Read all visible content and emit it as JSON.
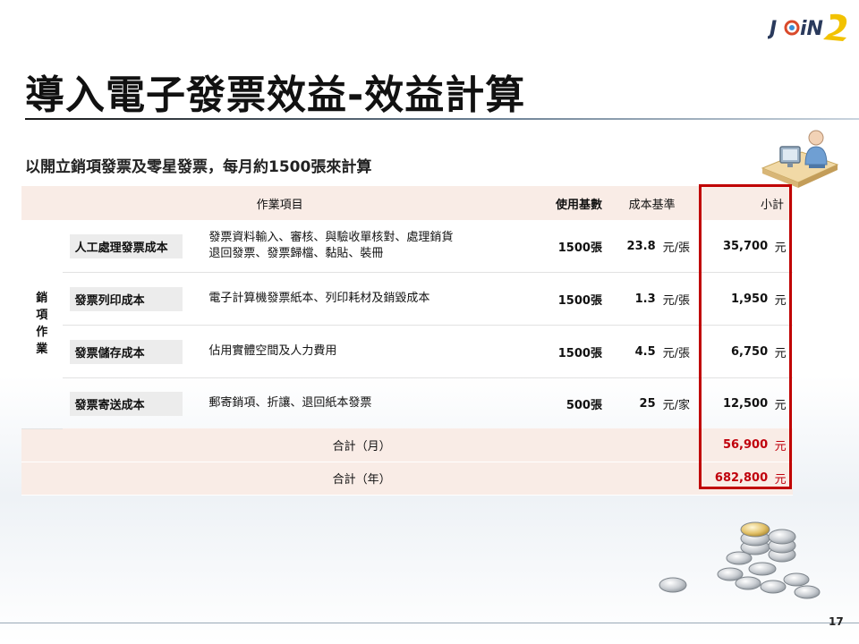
{
  "brand": {
    "logo_text": "JOIN"
  },
  "slide": {
    "title": "導入電子發票效益-效益計算",
    "subtitle": "以開立銷項發票及零星發票，每月約1500張來計算",
    "page_number": "17"
  },
  "table": {
    "headers": {
      "item": "作業項目",
      "count": "使用基數",
      "base": "成本基準",
      "subtotal": "小計"
    },
    "side_label": "銷項作業",
    "rows": [
      {
        "name": "人工處理發票成本",
        "desc_line1": "發票資料輸入、審核、與驗收單核對、處理銷貨",
        "desc_line2": "退回發票、發票歸檔、黏貼、裝冊",
        "count": "1500張",
        "base": "23.8",
        "unit": "元/張",
        "subtotal": "35,700",
        "currency": "元"
      },
      {
        "name": "發票列印成本",
        "desc_line1": "電子計算機發票紙本、列印耗材及銷毀成本",
        "desc_line2": "",
        "count": "1500張",
        "base": "1.3",
        "unit": "元/張",
        "subtotal": "1,950",
        "currency": "元"
      },
      {
        "name": "發票儲存成本",
        "desc_line1": "佔用實體空間及人力費用",
        "desc_line2": "",
        "count": "1500張",
        "base": "4.5",
        "unit": "元/張",
        "subtotal": "6,750",
        "currency": "元"
      },
      {
        "name": "發票寄送成本",
        "desc_line1": "郵寄銷項、折讓、退回紙本發票",
        "desc_line2": "",
        "count": "500張",
        "base": "25",
        "unit": "元/家",
        "subtotal": "12,500",
        "currency": "元"
      }
    ],
    "totals": [
      {
        "label": "合計（月）",
        "value": "56,900",
        "currency": "元"
      },
      {
        "label": "合計（年）",
        "value": "682,800",
        "currency": "元"
      }
    ]
  },
  "colors": {
    "highlight_frame": "#c00000",
    "total_text": "#c0000c",
    "header_bg": "#f9ece6",
    "name_box_bg": "#ececec"
  },
  "icons": [
    "join-logo",
    "person-at-computer-icon",
    "coins-icon"
  ]
}
